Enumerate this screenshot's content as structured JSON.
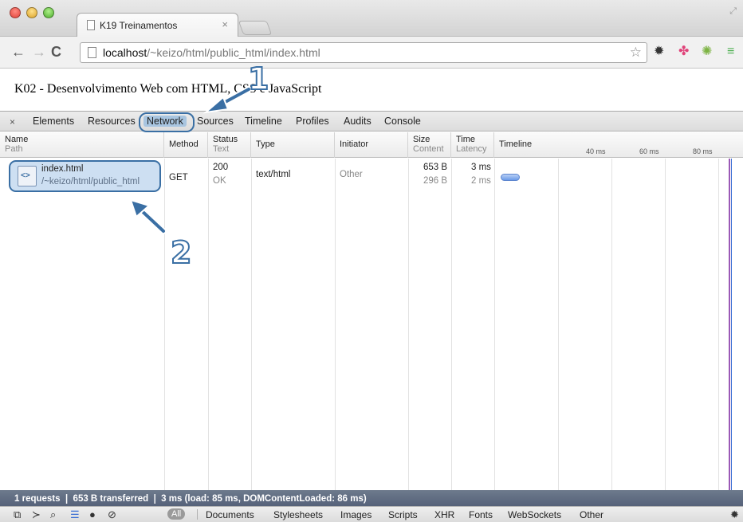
{
  "browser": {
    "tab_title": "K19 Treinamentos",
    "tab_close": "×",
    "url_host": "localhost",
    "url_path": "/~keizo/html/public_html/index.html"
  },
  "page": {
    "heading": "K02 - Desenvolvimento Web com HTML, CSS e JavaScript"
  },
  "devtools": {
    "close": "×",
    "tabs": [
      "Elements",
      "Resources",
      "Network",
      "Sources",
      "Timeline",
      "Profiles",
      "Audits",
      "Console"
    ],
    "selected_tab": "Network",
    "columns": {
      "name": "Name",
      "path": "Path",
      "method": "Method",
      "status": "Status",
      "status_text": "Text",
      "type": "Type",
      "initiator": "Initiator",
      "size": "Size",
      "size_content": "Content",
      "time": "Time",
      "time_latency": "Latency",
      "timeline": "Timeline"
    },
    "ticks": [
      "40 ms",
      "60 ms",
      "80 ms"
    ],
    "rows": [
      {
        "name": "index.html",
        "path": "/~keizo/html/public_html",
        "method": "GET",
        "status": "200",
        "status_text": "OK",
        "type": "text/html",
        "initiator": "Other",
        "size": "653 B",
        "content": "296 B",
        "time": "3 ms",
        "latency": "2 ms"
      }
    ],
    "summary": "1 requests  ❘  653 B transferred  ❘  3 ms (load: 85 ms, DOMContentLoaded: 86 ms)",
    "filters": {
      "all": "All",
      "items": [
        "Documents",
        "Stylesheets",
        "Images",
        "Scripts",
        "XHR",
        "Fonts",
        "WebSockets",
        "Other"
      ]
    }
  },
  "annotations": {
    "one": "1",
    "two": "2"
  },
  "colors": {
    "accent": "#3a6fa4",
    "highlight": "#cddff2",
    "status_bar": "#5f6b80"
  }
}
